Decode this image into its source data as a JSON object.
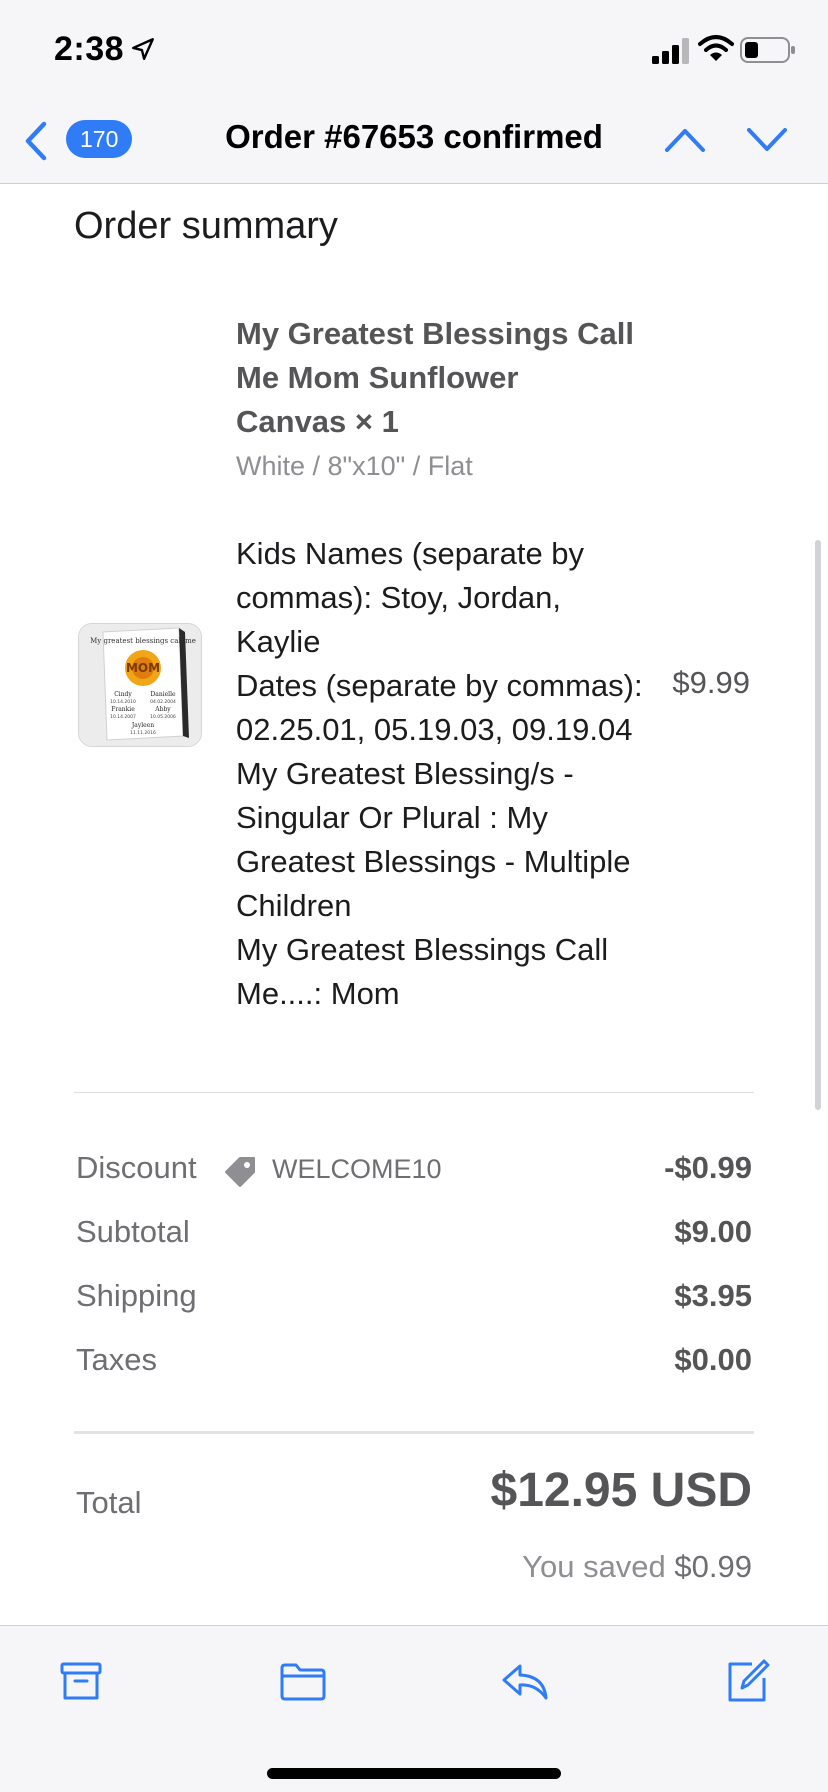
{
  "status_bar": {
    "time": "2:38",
    "icons": [
      "location-arrow-icon",
      "signal-icon",
      "wifi-icon",
      "battery-icon"
    ]
  },
  "nav": {
    "back_icon": "chevron-left-icon",
    "unread_count": "170",
    "title": "Order #67653 confirmed",
    "prev_icon": "chevron-up-icon",
    "next_icon": "chevron-down-icon"
  },
  "order_summary": {
    "heading": "Order summary",
    "item": {
      "title": "My Greatest Blessings Call Me Mom Sunflower Canvas × 1",
      "variant": "White / 8\"x10\" / Flat",
      "properties": [
        "Kids Names (separate by commas): Stoy, Jordan, Kaylie",
        "Dates (separate by commas): 02.25.01, 05.19.03, 09.19.04",
        "My Greatest Blessing/s - Singular Or Plural : My Greatest Blessings - Multiple Children",
        "My Greatest Blessings Call Me....: Mom"
      ],
      "price": "$9.99",
      "thumbnail": {
        "header": "My greatest blessings call me",
        "center": "MOM",
        "names": [
          "Cindy",
          "Danielle",
          "Frankie",
          "Abby",
          "Jayleen"
        ],
        "dates": [
          "10.14.2010",
          "04.02.2004",
          "10.14.2007",
          "10.05.2006",
          "11.11.2016"
        ]
      }
    },
    "lines": {
      "discount_label": "Discount",
      "discount_code": "WELCOME10",
      "discount_value": "-$0.99",
      "subtotal_label": "Subtotal",
      "subtotal_value": "$9.00",
      "shipping_label": "Shipping",
      "shipping_value": "$3.95",
      "taxes_label": "Taxes",
      "taxes_value": "$0.00"
    },
    "total": {
      "label": "Total",
      "value": "$12.95 USD",
      "saved_prefix": "You saved",
      "saved_amount": "$0.99"
    }
  },
  "toolbar": {
    "icons": [
      "archive-icon",
      "folder-icon",
      "reply-icon",
      "compose-icon"
    ]
  },
  "colors": {
    "accent": "#2f7cf6",
    "text_gray": "#555558",
    "label_gray": "#6e6e73"
  }
}
